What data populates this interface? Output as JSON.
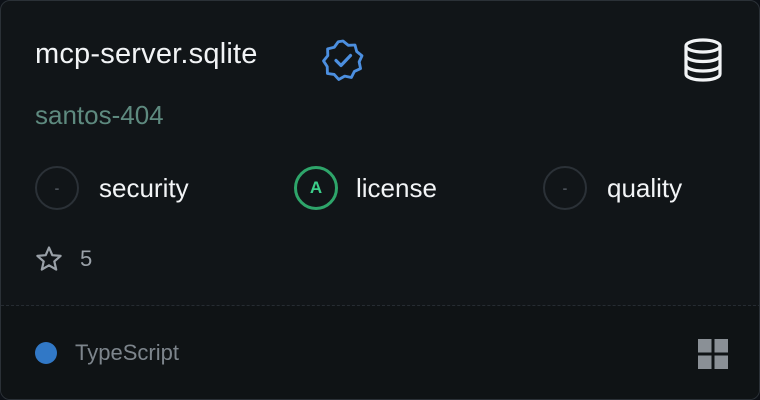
{
  "server": {
    "name": "mcp-server.sqlite",
    "owner": "santos-404",
    "verified_icon": "verified-badge-icon",
    "type_icon": "database-icon"
  },
  "scores": [
    {
      "grade": "-",
      "label": "security"
    },
    {
      "grade": "A",
      "label": "license"
    },
    {
      "grade": "-",
      "label": "quality"
    }
  ],
  "stats": {
    "stars": "5",
    "star_icon": "star-icon"
  },
  "footer": {
    "language": "TypeScript",
    "language_color": "#3178c6",
    "platform_icon": "windows-icon"
  },
  "colors": {
    "background": "#111518",
    "owner_text": "#5e8a7f",
    "grade_a": "#2ea56a",
    "verified": "#4c8fe0"
  }
}
